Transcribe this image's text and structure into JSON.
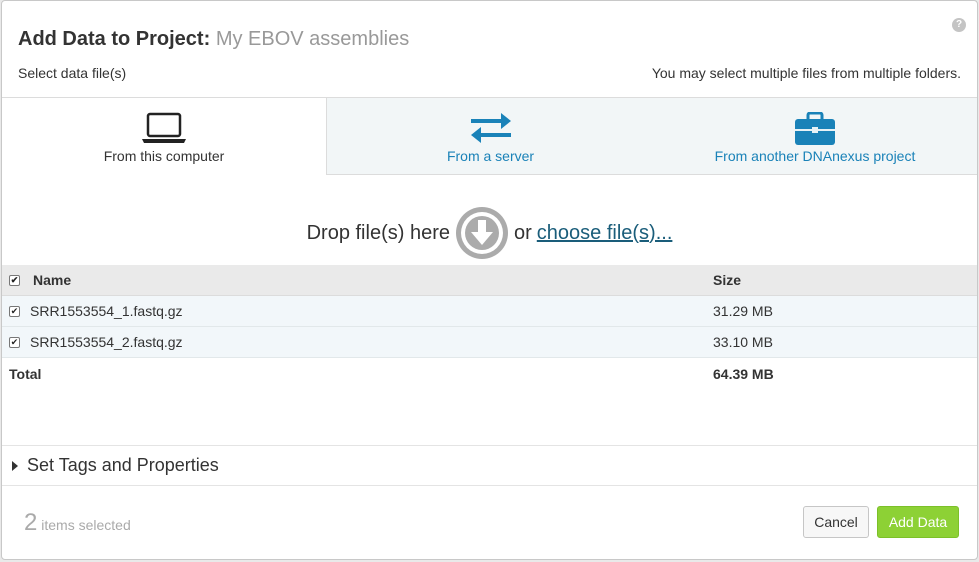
{
  "dialog": {
    "title": "Add Data to Project:",
    "project_name": "My EBOV assemblies",
    "help_glyph": "?",
    "subtitle_left": "Select data file(s)",
    "subtitle_right": "You may select multiple files from multiple folders."
  },
  "tabs": [
    {
      "label": "From this computer",
      "icon": "laptop-icon",
      "active": true
    },
    {
      "label": "From a server",
      "icon": "transfer-arrows-icon",
      "active": false
    },
    {
      "label": "From another DNAnexus project",
      "icon": "briefcase-icon",
      "active": false
    }
  ],
  "dropzone": {
    "prefix": "Drop file(s) here",
    "or": "or",
    "link": "choose file(s)..."
  },
  "table": {
    "headers": {
      "name": "Name",
      "size": "Size"
    },
    "rows": [
      {
        "name": "SRR1553554_1.fastq.gz",
        "size": "31.29 MB",
        "checked": true
      },
      {
        "name": "SRR1553554_2.fastq.gz",
        "size": "33.10 MB",
        "checked": true
      }
    ],
    "total": {
      "label": "Total",
      "size": "64.39 MB"
    },
    "check_glyph": "✔"
  },
  "tags_section": {
    "label": "Set Tags and Properties"
  },
  "footer": {
    "count": "2",
    "count_label": "items selected",
    "cancel_label": "Cancel",
    "add_label": "Add Data"
  },
  "colors": {
    "accent_blue": "#1a82b8",
    "add_button_green": "#8dd135",
    "drop_icon_gray": "#ababab"
  }
}
